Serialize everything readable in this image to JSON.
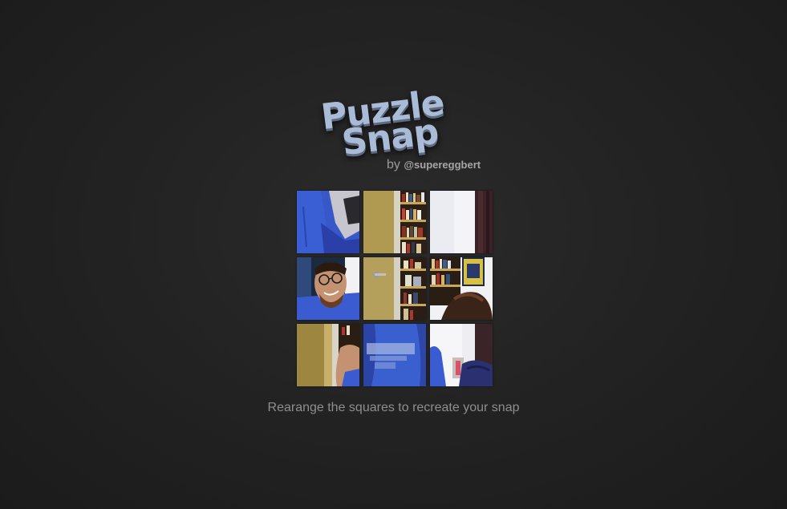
{
  "logo": {
    "line1": "Puzzle",
    "line2": "Snap"
  },
  "byline": {
    "prefix": "by",
    "handle": "@supereggbert"
  },
  "board": {
    "rows": 3,
    "cols": 3,
    "tiles": [
      {
        "content": "blue-shirt-shoulder"
      },
      {
        "content": "door-and-bookshelf"
      },
      {
        "content": "white-wall-curtain"
      },
      {
        "content": "smiling-face-glasses"
      },
      {
        "content": "door-handle-bookshelf"
      },
      {
        "content": "bookshelf-picture-hair"
      },
      {
        "content": "door-arm"
      },
      {
        "content": "blue-shirt-print"
      },
      {
        "content": "shirt-shoulder-room"
      }
    ]
  },
  "instructions": "Rearange the squares to recreate your snap"
}
